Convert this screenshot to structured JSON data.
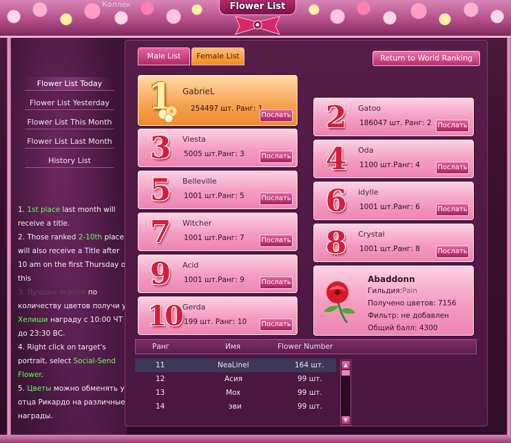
{
  "window": {
    "title": "Flower List",
    "faded_top_text": "Коллек"
  },
  "tabs": {
    "male": "Male List",
    "female": "Female List"
  },
  "return_button": "Return to World Ranking",
  "nav": [
    {
      "label": "Flower List Today"
    },
    {
      "label": "Flower List Yesterday"
    },
    {
      "label": "Flower List This Month"
    },
    {
      "label": "Flower List Last Month"
    },
    {
      "label": "History List"
    }
  ],
  "rules": {
    "r1_prefix": "1. ",
    "r1_green": "1st place",
    "r1_rest": " last month will receive a title.",
    "r2_prefix": "2. Those ranked ",
    "r2_green": "2-10th",
    "r2_rest": " place will also receive a Title after 10 am on the first Thursday of this",
    "r3_ghost": "3. Лучшие игроки",
    "r3_line": "по количеству цветов получи у ",
    "r3_green": "Хелиши",
    "r3_rest": " награду с 10:00 ЧТ до 23:30 ВС.",
    "r4_prefix": "4. Right click on target's portrait, select ",
    "r4_green": "Social-Send Flower",
    "r4_rest": ".",
    "r5_prefix": "5. ",
    "r5_green": "Цветы",
    "r5_rest": " можно обменять у отца Рикардо на различные награды."
  },
  "send_label": "Послать",
  "top1": {
    "rank_num": "1",
    "name": "GabrieL",
    "count": "254497 шт.",
    "rank": "Ранг: 1"
  },
  "cards": [
    {
      "rank_num": "2",
      "name": "Gatoo",
      "count": "186047 шт.",
      "rank": "Ранг: 2"
    },
    {
      "rank_num": "3",
      "name": "Viesta",
      "count": "5005 шт.",
      "rank": "Ранг: 3"
    },
    {
      "rank_num": "4",
      "name": "Oda",
      "count": "1100 шт.",
      "rank": "Ранг: 4"
    },
    {
      "rank_num": "5",
      "name": "Belleville",
      "count": "1001 шт.",
      "rank": "Ранг: 5"
    },
    {
      "rank_num": "6",
      "name": "idylle",
      "count": "1001 шт.",
      "rank": "Ранг: 6"
    },
    {
      "rank_num": "7",
      "name": "Witcher",
      "count": "1001 шт.",
      "rank": "Ранг: 7"
    },
    {
      "rank_num": "8",
      "name": "Crystal",
      "count": "1001 шт.",
      "rank": "Ранг: 8"
    },
    {
      "rank_num": "9",
      "name": "Acid",
      "count": "1001 шт.",
      "rank": "Ранг: 9"
    },
    {
      "rank_num": "10",
      "name": "Gerda",
      "count": "199 шт.",
      "rank": "Ранг: 10"
    }
  ],
  "info": {
    "name": "Abaddonn",
    "guild": "Гильдия:",
    "guild_ghost": "Pain",
    "received": "Получено цветов: 7156",
    "filter": "Фильтр: не добавлен",
    "score": "Общий балл: 4300"
  },
  "table": {
    "headers": {
      "rank": "Ранг",
      "name": "Имя",
      "number": "Flower Number"
    },
    "rows": [
      {
        "rank": "11",
        "name": "NeaLinel",
        "count": "164 шт."
      },
      {
        "rank": "12",
        "name": "Асия",
        "count": "99 шт."
      },
      {
        "rank": "13",
        "name": "Mox",
        "count": "99 шт."
      },
      {
        "rank": "14",
        "name": "эви",
        "count": "99 шт."
      }
    ]
  },
  "colors": {
    "accent_pink": "#e8619d",
    "tab_orange": "#f08a1c",
    "rule_green": "#5cff5c",
    "number_red": "#d91c3b"
  }
}
